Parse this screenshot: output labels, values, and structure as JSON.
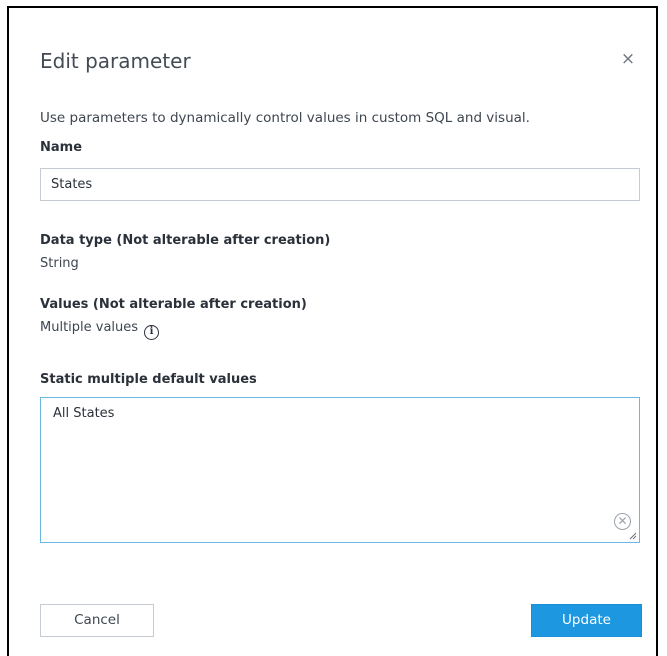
{
  "dialog": {
    "title": "Edit parameter",
    "close_symbol": "×",
    "description": "Use parameters to dynamically control values in custom SQL and visual."
  },
  "name_field": {
    "label": "Name",
    "value": "States"
  },
  "data_type": {
    "label": "Data type (Not alterable after creation)",
    "value": "String"
  },
  "values": {
    "label": "Values (Not alterable after creation)",
    "value": "Multiple values",
    "info_icon": "info-icon"
  },
  "default_values": {
    "label": "Static multiple default values",
    "value": "All States",
    "clear_icon": "clear-icon"
  },
  "footer": {
    "cancel_label": "Cancel",
    "update_label": "Update"
  },
  "colors": {
    "primary": "#1c97e0",
    "focus_border": "#6ab6e6",
    "dialog_border": "#000000"
  }
}
